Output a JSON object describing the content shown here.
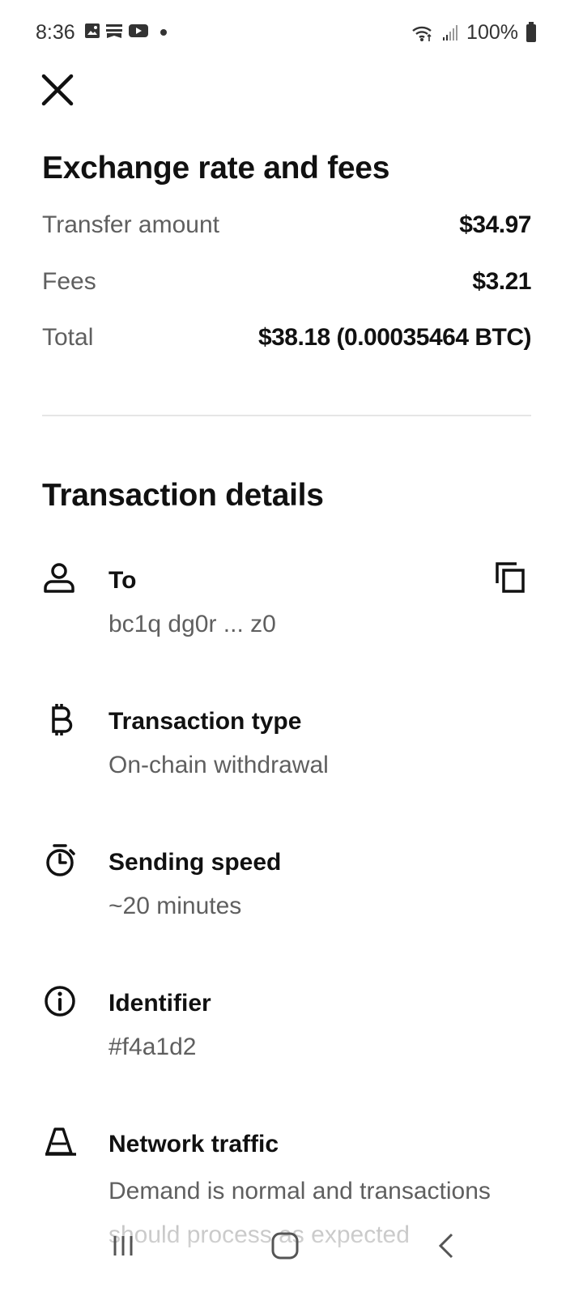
{
  "status_bar": {
    "time": "8:36",
    "battery": "100%"
  },
  "fees_section": {
    "title": "Exchange rate and fees",
    "rows": [
      {
        "label": "Transfer amount",
        "value": "$34.97"
      },
      {
        "label": "Fees",
        "value": "$3.21"
      },
      {
        "label": "Total",
        "value": "$38.18 (0.00035464 BTC)"
      }
    ]
  },
  "details_section": {
    "title": "Transaction details",
    "items": [
      {
        "label": "To",
        "value": "bc1q dg0r ... z0",
        "icon": "person-icon"
      },
      {
        "label": "Transaction type",
        "value": "On-chain withdrawal",
        "icon": "bitcoin-icon"
      },
      {
        "label": "Sending speed",
        "value": "~20 minutes",
        "icon": "stopwatch-icon"
      },
      {
        "label": "Identifier",
        "value": "#f4a1d2",
        "icon": "info-icon"
      },
      {
        "label": "Network traffic",
        "value": "Demand is normal and transactions should process as expected",
        "icon": "traffic-cone-icon"
      }
    ]
  }
}
